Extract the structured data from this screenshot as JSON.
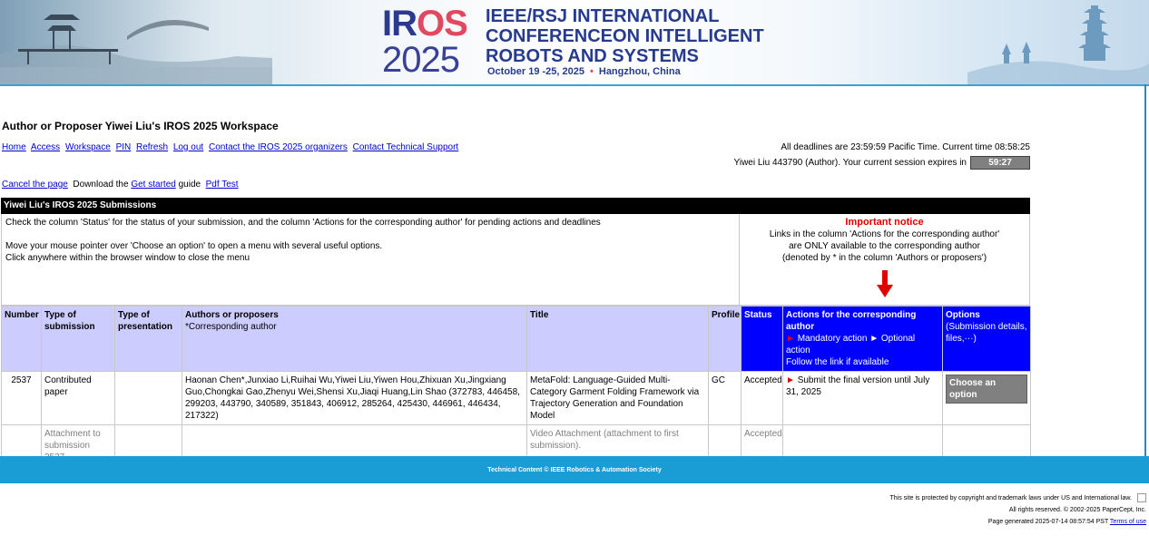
{
  "banner": {
    "logo_word_ir": "IR",
    "logo_word_os": "OS",
    "logo_year": "2025",
    "conf_line1": "IEEE/RSJ INTERNATIONAL",
    "conf_line2": "CONFERENCEON INTELLIGENT",
    "conf_line3": "ROBOTS AND SYSTEMS",
    "dates": "October 19 -25, 2025",
    "location": "Hangzhou, China"
  },
  "workspace_title": "Author or Proposer Yiwei Liu's IROS 2025 Workspace",
  "nav": {
    "home": "Home",
    "access": "Access",
    "workspace": "Workspace",
    "pin": "PIN",
    "refresh": "Refresh",
    "logout": "Log out",
    "contact_organizers": "Contact the IROS 2025 organizers",
    "contact_support": "Contact Technical Support"
  },
  "deadline_text": "All deadlines are 23:59:59 Pacific Time. Current time 08:58:25",
  "session_text": "Yiwei Liu 443790 (Author). Your current session expires in",
  "session_timer": "59:27",
  "cancel_link": "Cancel the page",
  "download_pre": "Download the",
  "get_started_link": "Get started",
  "guide_text": "guide",
  "pdf_test_link": "Pdf Test",
  "submissions": {
    "heading": "Yiwei Liu's IROS 2025 Submissions",
    "notice_line1": "Check the column 'Status' for the status of your submission, and the column 'Actions for the corresponding author' for pending actions and deadlines",
    "notice_line2": "Move your mouse pointer over 'Choose an option' to open a menu with several useful options.",
    "notice_line3": "Click anywhere within the browser window to close the menu",
    "important_title": "Important notice",
    "important_line1": "Links in the column 'Actions for the corresponding author'",
    "important_line2": "are ONLY available to the corresponding author",
    "important_line3": "(denoted by * in the column 'Authors or proposers')",
    "columns": {
      "number": "Number",
      "type_submission": "Type of submission",
      "type_presentation": "Type of presentation",
      "authors": "Authors or proposers",
      "authors_sub": "*Corresponding author",
      "title": "Title",
      "profile": "Profile",
      "status": "Status",
      "actions": "Actions for the corresponding author",
      "actions_mandatory": "Mandatory action",
      "actions_optional": "Optional action",
      "actions_follow": "Follow the link if available",
      "options": "Options",
      "options_sub": "(Submission details, files,···)"
    },
    "rows": [
      {
        "number": "2537",
        "type_submission": "Contributed paper",
        "type_presentation": "",
        "authors": "Haonan Chen*,Junxiao Li,Ruihai Wu,Yiwei Liu,Yiwen Hou,Zhixuan Xu,Jingxiang Guo,Chongkai Gao,Zhenyu Wei,Shensi Xu,Jiaqi Huang,Lin Shao (372783, 446458, 299203, 443790, 340589, 351843, 406912, 285264, 425430, 446961, 446434, 217322)",
        "title": "MetaFold: Language-Guided Multi-Category Garment Folding Framework via Trajectory Generation and Foundation Model",
        "profile": "GC",
        "status": "Accepted",
        "action": "Submit the final version until July 31, 2025",
        "option_button": "Choose an option"
      },
      {
        "number": "",
        "type_submission": "Attachment to submission 2537",
        "type_presentation": "",
        "authors": "",
        "title": "Video Attachment (attachment to first submission).",
        "profile": "",
        "status": "Accepted",
        "action": "",
        "option_button": ""
      }
    ]
  },
  "footer": {
    "bar_text": "Technical Content © IEEE Robotics & Automation Society",
    "legal_line1": "This site is protected by copyright and trademark laws under US and International law.",
    "legal_line2": "All rights reserved. © 2002-2025 PaperCept, Inc.",
    "legal_line3": "Page generated 2025-07-14  08:57:54 PST",
    "terms_link": "Terms of use"
  },
  "colors": {
    "header_black": "#000000",
    "column_header": "#ccccff",
    "highlight_blue": "#0000ff",
    "notice_red": "#e00000",
    "footer_blue": "#1a9cd4"
  }
}
